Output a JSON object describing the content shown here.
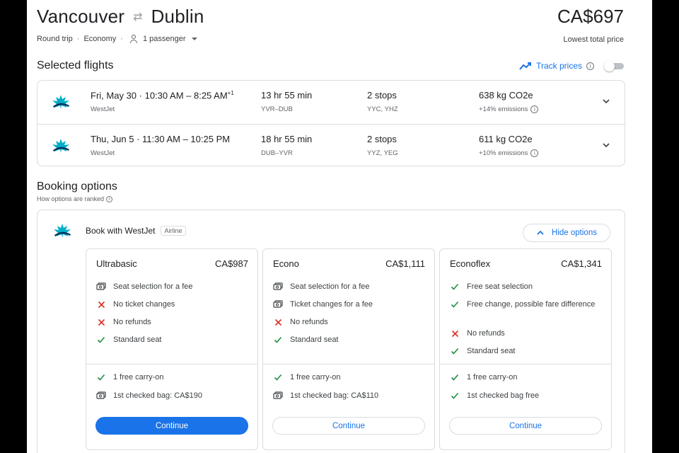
{
  "header": {
    "origin": "Vancouver",
    "destination": "Dublin",
    "swap_icon": "swap-arrows-icon",
    "price": "CA$697",
    "price_caption": "Lowest total price",
    "trip_type": "Round trip",
    "cabin": "Economy",
    "passengers": "1 passenger"
  },
  "selected": {
    "title": "Selected flights",
    "track_label": "Track prices",
    "track_on": false
  },
  "flights": [
    {
      "date": "Fri, May 30",
      "times": "10:30 AM – 8:25 AM",
      "plus_day": "+1",
      "airline": "WestJet",
      "duration": "13 hr 55 min",
      "route": "YVR–DUB",
      "stops": "2 stops",
      "stop_airports": "YYC, YHZ",
      "co2": "638 kg CO2e",
      "emissions": "+14% emissions"
    },
    {
      "date": "Thu, Jun 5",
      "times": "11:30 AM – 10:25 PM",
      "plus_day": "",
      "airline": "WestJet",
      "duration": "18 hr 55 min",
      "route": "DUB–YVR",
      "stops": "2 stops",
      "stop_airports": "YYZ, YEG",
      "co2": "611 kg CO2e",
      "emissions": "+10% emissions"
    }
  ],
  "booking": {
    "title": "Booking options",
    "subtitle": "How options are ranked",
    "provider": "Book with WestJet",
    "provider_tag": "Airline",
    "hide_label": "Hide options",
    "fares": [
      {
        "name": "Ultrabasic",
        "price": "CA$987",
        "features": [
          {
            "icon": "money-icon",
            "text": "Seat selection for a fee"
          },
          {
            "icon": "cross-icon",
            "text": "No ticket changes"
          },
          {
            "icon": "cross-icon",
            "text": "No refunds"
          },
          {
            "icon": "check-icon",
            "text": "Standard seat"
          }
        ],
        "bags": [
          {
            "icon": "check-icon",
            "text": "1 free carry-on"
          },
          {
            "icon": "money-icon",
            "text": "1st checked bag: CA$190"
          }
        ],
        "button": "Continue"
      },
      {
        "name": "Econo",
        "price": "CA$1,111",
        "features": [
          {
            "icon": "money-icon",
            "text": "Seat selection for a fee"
          },
          {
            "icon": "money-icon",
            "text": "Ticket changes for a fee"
          },
          {
            "icon": "cross-icon",
            "text": "No refunds"
          },
          {
            "icon": "check-icon",
            "text": "Standard seat"
          }
        ],
        "bags": [
          {
            "icon": "check-icon",
            "text": "1 free carry-on"
          },
          {
            "icon": "money-icon",
            "text": "1st checked bag: CA$110"
          }
        ],
        "button": "Continue"
      },
      {
        "name": "Econoflex",
        "price": "CA$1,341",
        "features": [
          {
            "icon": "check-icon",
            "text": "Free seat selection"
          },
          {
            "icon": "check-icon",
            "text": "Free change, possible fare difference"
          },
          {
            "icon": "cross-icon",
            "text": "No refunds"
          },
          {
            "icon": "check-icon",
            "text": "Standard seat"
          }
        ],
        "bags": [
          {
            "icon": "check-icon",
            "text": "1 free carry-on"
          },
          {
            "icon": "check-icon",
            "text": "1st checked bag free"
          }
        ],
        "button": "Continue"
      }
    ]
  },
  "colors": {
    "accent": "#1a73e8",
    "check": "#1e8e3e",
    "cross": "#d93025",
    "logo": "#00aec7",
    "logo_dark": "#0b2f5c"
  }
}
